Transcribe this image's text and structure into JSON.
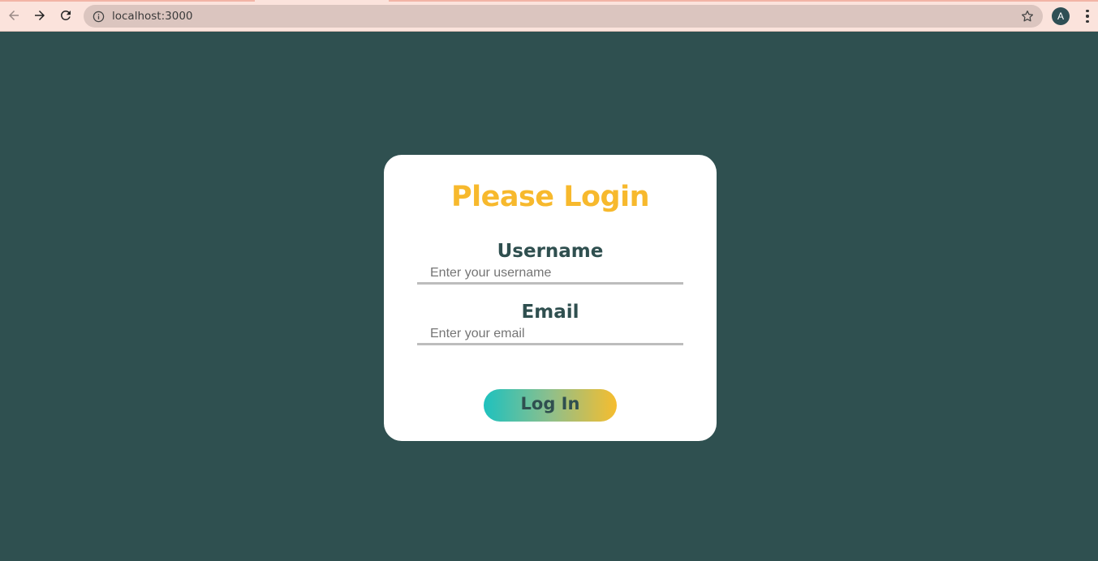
{
  "browser": {
    "url": "localhost:3000",
    "profile_initial": "A"
  },
  "login": {
    "title": "Please Login",
    "username_label": "Username",
    "username_placeholder": "Enter your username",
    "username_value": "",
    "email_label": "Email",
    "email_placeholder": "Enter your email",
    "email_value": "",
    "submit_label": "Log In"
  },
  "colors": {
    "page_background": "#2f5050",
    "title": "#f7b92d",
    "label": "#2f4f4f",
    "button_gradient_start": "#1ec1be",
    "button_gradient_end": "#f6bd2e"
  },
  "icons": {
    "back": "arrow-left-icon",
    "forward": "arrow-right-icon",
    "reload": "reload-icon",
    "site_info": "info-icon",
    "bookmark": "star-icon",
    "menu": "kebab-menu-icon"
  }
}
